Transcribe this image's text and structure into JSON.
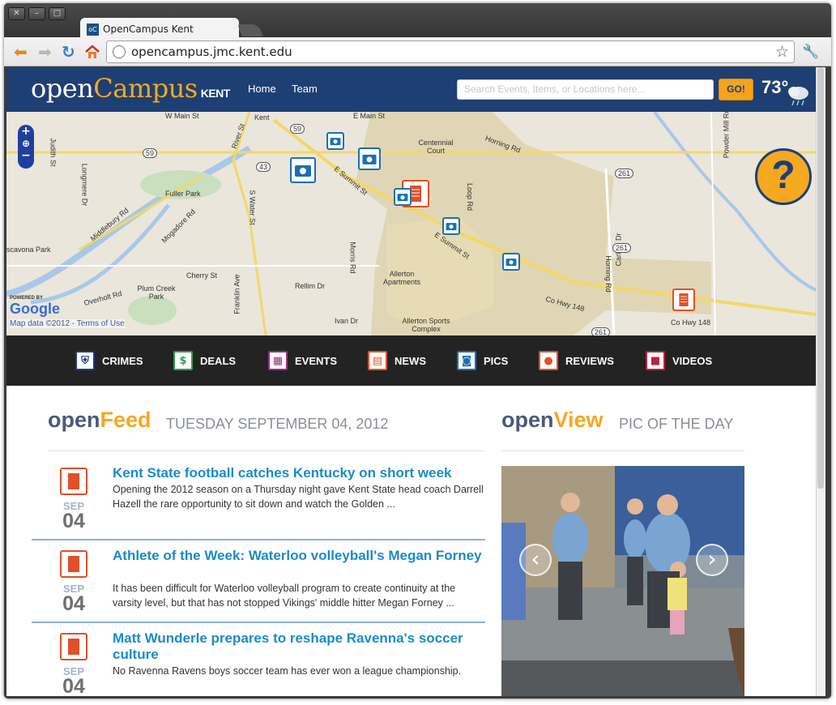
{
  "browser": {
    "window_controls": [
      "✕",
      "–",
      "□"
    ],
    "tab_title": "OpenCampus Kent",
    "favicon_text": "oC",
    "url": "opencampus.jmc.kent.edu"
  },
  "site": {
    "logo_open": "open",
    "logo_campus": "Campus",
    "logo_kent": "KENT",
    "nav": [
      "Home",
      "Team"
    ],
    "search_placeholder": "Search Events, Items, or Locations here...",
    "go_label": "GO!",
    "temperature": "73°",
    "weather_icon": "rain-cloud-icon",
    "help_label": "?"
  },
  "map": {
    "labels": {
      "kent": "Kent",
      "w_main": "W Main St",
      "e_main": "E Main St",
      "centennial": "Centennial Court",
      "horning": "Horning Rd",
      "fuller": "Fuller Park",
      "middlebury": "Middlebury Rd",
      "mogadore": "Mogadore Rd",
      "s_water": "S Water St",
      "e_summit": "E Summit St",
      "cherry": "Cherry St",
      "plum": "Plum Creek Park",
      "franklin": "Franklin Ave",
      "rellim": "Rellim Dr",
      "morris": "Morris Rd",
      "allerton": "Allerton Apartments",
      "allerton_sports": "Allerton Sports Complex",
      "ivan": "Ivan Dr",
      "co_hwy": "Co Hwy 148",
      "loop": "Loop Rd",
      "carlton": "Carlton Dr",
      "powder": "Powder Mill Rd",
      "judith": "Judith St",
      "longmere": "Longmere Dr",
      "overholt": "Overholt Rd",
      "river": "River St",
      "cavona": "scavona Park",
      "rd59": "59",
      "rd43": "43",
      "rd261a": "261",
      "rd261b": "261",
      "rd261c": "261"
    },
    "powered_by": "POWERED BY",
    "google": "Google",
    "data_credit": "Map data ©2012 - Terms of Use"
  },
  "categories": [
    {
      "label": "CRIMES",
      "icon": "shield-icon",
      "color": "#1f3a8a"
    },
    {
      "label": "DEALS",
      "icon": "dollar-icon",
      "color": "#2e9e4a"
    },
    {
      "label": "EVENTS",
      "icon": "calendar-icon",
      "color": "#9b2a8c"
    },
    {
      "label": "NEWS",
      "icon": "newspaper-icon",
      "color": "#e0502a"
    },
    {
      "label": "PICS",
      "icon": "camera-icon",
      "color": "#1a6fb8"
    },
    {
      "label": "REVIEWS",
      "icon": "review-icon",
      "color": "#e0502a"
    },
    {
      "label": "VIDEOS",
      "icon": "video-icon",
      "color": "#c0203a"
    }
  ],
  "feed": {
    "title_a": "open",
    "title_b": "Feed",
    "date": "TUESDAY SEPTEMBER 04, 2012",
    "items": [
      {
        "headline": "Kent State football catches Kentucky on short week",
        "snippet": "Opening the 2012 season on a Thursday night gave Kent State head coach Darrell Hazell the rare opportunity to sit down and watch the Golden ...",
        "month": "SEP",
        "day": "04"
      },
      {
        "headline": "Athlete of the Week: Waterloo volleyball's Megan Forney",
        "snippet": "It has been difficult for Waterloo volleyball program to create continuity at the varsity level, but that has not stopped Vikings' middle hitter Megan Forney ...",
        "month": "SEP",
        "day": "04"
      },
      {
        "headline": "Matt Wunderle prepares to reshape Ravenna's soccer culture",
        "snippet": "No Ravenna Ravens boys soccer team has ever won a league championship.",
        "month": "SEP",
        "day": "04"
      }
    ]
  },
  "view": {
    "title_a": "open",
    "title_b": "View",
    "subtitle": "PIC OF THE DAY",
    "prev_label": "‹",
    "next_label": "›"
  }
}
